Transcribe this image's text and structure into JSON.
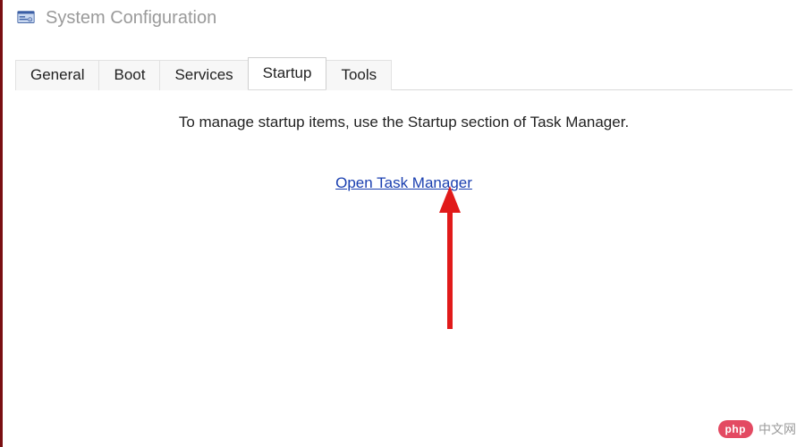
{
  "window": {
    "title": "System Configuration"
  },
  "tabs": [
    {
      "label": "General",
      "active": false
    },
    {
      "label": "Boot",
      "active": false
    },
    {
      "label": "Services",
      "active": false
    },
    {
      "label": "Startup",
      "active": true
    },
    {
      "label": "Tools",
      "active": false
    }
  ],
  "startup_panel": {
    "message": "To manage startup items, use the Startup section of Task Manager.",
    "link_label": "Open Task Manager"
  },
  "annotation": {
    "arrow_color": "#e11a1a"
  },
  "watermark": {
    "badge": "php",
    "text": "中文网"
  }
}
